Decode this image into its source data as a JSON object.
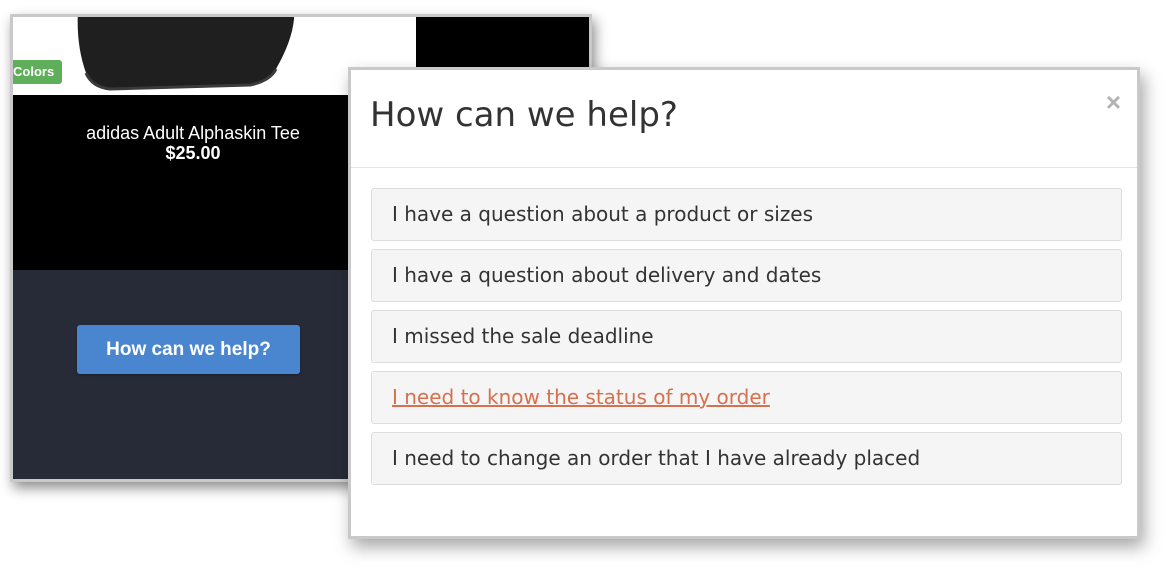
{
  "product": {
    "colors_badge": "Colors",
    "name": "adidas Adult Alphaskin Tee",
    "price": "$25.00",
    "help_button_label": "How can we help?"
  },
  "modal": {
    "title": "How can we help?",
    "close_label": "×",
    "options": [
      "I have a question about a product or sizes",
      "I have a question about delivery and dates",
      "I missed the sale deadline",
      "I need to know the status of my order",
      "I need to change an order that I have already placed"
    ],
    "hovered_option_index": 3,
    "hover_color": "#d6704f"
  },
  "colors": {
    "badge_green": "#5fae5a",
    "button_blue": "#4a86cf",
    "panel_dark": "#262b37"
  }
}
